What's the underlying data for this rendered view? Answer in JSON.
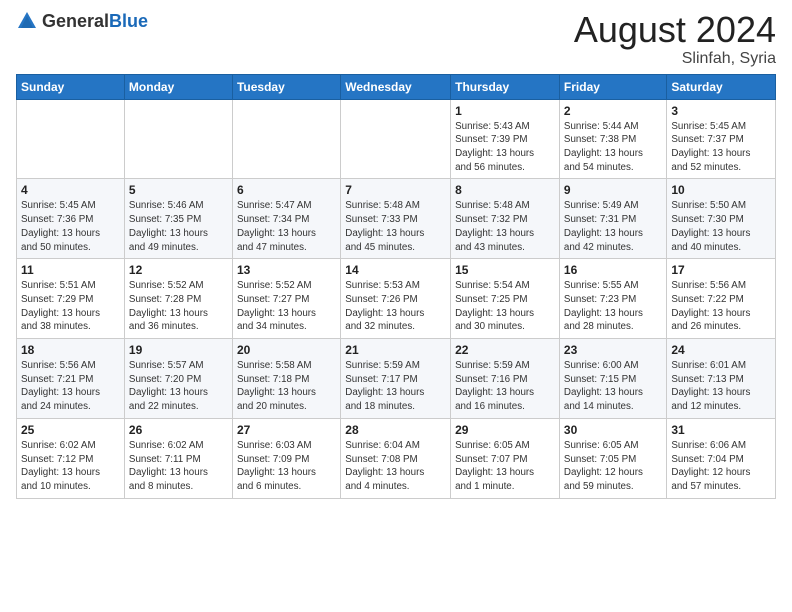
{
  "header": {
    "logo_general": "General",
    "logo_blue": "Blue",
    "main_title": "August 2024",
    "subtitle": "Slinfah, Syria"
  },
  "calendar": {
    "weekdays": [
      "Sunday",
      "Monday",
      "Tuesday",
      "Wednesday",
      "Thursday",
      "Friday",
      "Saturday"
    ],
    "weeks": [
      [
        {
          "day": "",
          "info": ""
        },
        {
          "day": "",
          "info": ""
        },
        {
          "day": "",
          "info": ""
        },
        {
          "day": "",
          "info": ""
        },
        {
          "day": "1",
          "info": "Sunrise: 5:43 AM\nSunset: 7:39 PM\nDaylight: 13 hours\nand 56 minutes."
        },
        {
          "day": "2",
          "info": "Sunrise: 5:44 AM\nSunset: 7:38 PM\nDaylight: 13 hours\nand 54 minutes."
        },
        {
          "day": "3",
          "info": "Sunrise: 5:45 AM\nSunset: 7:37 PM\nDaylight: 13 hours\nand 52 minutes."
        }
      ],
      [
        {
          "day": "4",
          "info": "Sunrise: 5:45 AM\nSunset: 7:36 PM\nDaylight: 13 hours\nand 50 minutes."
        },
        {
          "day": "5",
          "info": "Sunrise: 5:46 AM\nSunset: 7:35 PM\nDaylight: 13 hours\nand 49 minutes."
        },
        {
          "day": "6",
          "info": "Sunrise: 5:47 AM\nSunset: 7:34 PM\nDaylight: 13 hours\nand 47 minutes."
        },
        {
          "day": "7",
          "info": "Sunrise: 5:48 AM\nSunset: 7:33 PM\nDaylight: 13 hours\nand 45 minutes."
        },
        {
          "day": "8",
          "info": "Sunrise: 5:48 AM\nSunset: 7:32 PM\nDaylight: 13 hours\nand 43 minutes."
        },
        {
          "day": "9",
          "info": "Sunrise: 5:49 AM\nSunset: 7:31 PM\nDaylight: 13 hours\nand 42 minutes."
        },
        {
          "day": "10",
          "info": "Sunrise: 5:50 AM\nSunset: 7:30 PM\nDaylight: 13 hours\nand 40 minutes."
        }
      ],
      [
        {
          "day": "11",
          "info": "Sunrise: 5:51 AM\nSunset: 7:29 PM\nDaylight: 13 hours\nand 38 minutes."
        },
        {
          "day": "12",
          "info": "Sunrise: 5:52 AM\nSunset: 7:28 PM\nDaylight: 13 hours\nand 36 minutes."
        },
        {
          "day": "13",
          "info": "Sunrise: 5:52 AM\nSunset: 7:27 PM\nDaylight: 13 hours\nand 34 minutes."
        },
        {
          "day": "14",
          "info": "Sunrise: 5:53 AM\nSunset: 7:26 PM\nDaylight: 13 hours\nand 32 minutes."
        },
        {
          "day": "15",
          "info": "Sunrise: 5:54 AM\nSunset: 7:25 PM\nDaylight: 13 hours\nand 30 minutes."
        },
        {
          "day": "16",
          "info": "Sunrise: 5:55 AM\nSunset: 7:23 PM\nDaylight: 13 hours\nand 28 minutes."
        },
        {
          "day": "17",
          "info": "Sunrise: 5:56 AM\nSunset: 7:22 PM\nDaylight: 13 hours\nand 26 minutes."
        }
      ],
      [
        {
          "day": "18",
          "info": "Sunrise: 5:56 AM\nSunset: 7:21 PM\nDaylight: 13 hours\nand 24 minutes."
        },
        {
          "day": "19",
          "info": "Sunrise: 5:57 AM\nSunset: 7:20 PM\nDaylight: 13 hours\nand 22 minutes."
        },
        {
          "day": "20",
          "info": "Sunrise: 5:58 AM\nSunset: 7:18 PM\nDaylight: 13 hours\nand 20 minutes."
        },
        {
          "day": "21",
          "info": "Sunrise: 5:59 AM\nSunset: 7:17 PM\nDaylight: 13 hours\nand 18 minutes."
        },
        {
          "day": "22",
          "info": "Sunrise: 5:59 AM\nSunset: 7:16 PM\nDaylight: 13 hours\nand 16 minutes."
        },
        {
          "day": "23",
          "info": "Sunrise: 6:00 AM\nSunset: 7:15 PM\nDaylight: 13 hours\nand 14 minutes."
        },
        {
          "day": "24",
          "info": "Sunrise: 6:01 AM\nSunset: 7:13 PM\nDaylight: 13 hours\nand 12 minutes."
        }
      ],
      [
        {
          "day": "25",
          "info": "Sunrise: 6:02 AM\nSunset: 7:12 PM\nDaylight: 13 hours\nand 10 minutes."
        },
        {
          "day": "26",
          "info": "Sunrise: 6:02 AM\nSunset: 7:11 PM\nDaylight: 13 hours\nand 8 minutes."
        },
        {
          "day": "27",
          "info": "Sunrise: 6:03 AM\nSunset: 7:09 PM\nDaylight: 13 hours\nand 6 minutes."
        },
        {
          "day": "28",
          "info": "Sunrise: 6:04 AM\nSunset: 7:08 PM\nDaylight: 13 hours\nand 4 minutes."
        },
        {
          "day": "29",
          "info": "Sunrise: 6:05 AM\nSunset: 7:07 PM\nDaylight: 13 hours\nand 1 minute."
        },
        {
          "day": "30",
          "info": "Sunrise: 6:05 AM\nSunset: 7:05 PM\nDaylight: 12 hours\nand 59 minutes."
        },
        {
          "day": "31",
          "info": "Sunrise: 6:06 AM\nSunset: 7:04 PM\nDaylight: 12 hours\nand 57 minutes."
        }
      ]
    ]
  }
}
